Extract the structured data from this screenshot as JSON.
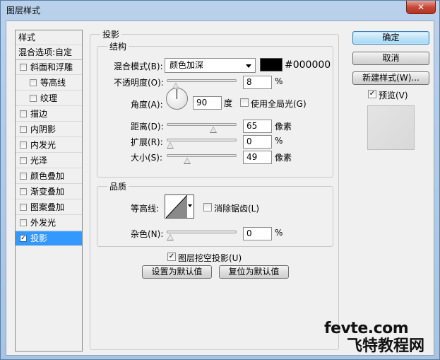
{
  "window": {
    "title": "图层样式",
    "close_label": "✕"
  },
  "sidebar": {
    "header": "样式",
    "blend_options": "混合选项:自定",
    "items": [
      {
        "label": "斜面和浮雕",
        "checked": false
      },
      {
        "label": "等高线",
        "checked": false
      },
      {
        "label": "纹理",
        "checked": false
      },
      {
        "label": "描边",
        "checked": false
      },
      {
        "label": "内阴影",
        "checked": false
      },
      {
        "label": "内发光",
        "checked": false
      },
      {
        "label": "光泽",
        "checked": false
      },
      {
        "label": "颜色叠加",
        "checked": false
      },
      {
        "label": "渐变叠加",
        "checked": false
      },
      {
        "label": "图案叠加",
        "checked": false
      },
      {
        "label": "外发光",
        "checked": false
      },
      {
        "label": "投影",
        "checked": true
      }
    ],
    "check_mark": "✓"
  },
  "shadow": {
    "group_title": "投影",
    "structure": {
      "title": "结构",
      "blend_mode_label": "混合模式(B):",
      "blend_mode_value": "颜色加深",
      "color_hex": "#000000",
      "color_swatch": "#000000",
      "opacity_label": "不透明度(O):",
      "opacity_value": "8",
      "opacity_unit": "%",
      "opacity_fraction": 0.08,
      "angle_label": "角度(A):",
      "angle_value": "90",
      "angle_unit": "度",
      "global_light_label": "使用全局光(G)",
      "global_light_checked": false,
      "distance_label": "距离(D):",
      "distance_value": "65",
      "distance_unit": "像素",
      "distance_fraction": 0.65,
      "spread_label": "扩展(R):",
      "spread_value": "0",
      "spread_unit": "%",
      "spread_fraction": 0.0,
      "size_label": "大小(S):",
      "size_value": "49",
      "size_unit": "像素",
      "size_fraction": 0.25
    },
    "quality": {
      "title": "品质",
      "contour_label": "等高线:",
      "antialias_label": "消除锯齿(L)",
      "antialias_checked": false,
      "noise_label": "杂色(N):",
      "noise_value": "0",
      "noise_unit": "%",
      "noise_fraction": 0.0
    },
    "knockout_label": "图层挖空投影(U)",
    "knockout_checked": true,
    "make_default": "设置为默认值",
    "reset_default": "复位为默认值"
  },
  "buttons": {
    "ok": "确定",
    "cancel": "取消",
    "new_style": "新建样式(W)...",
    "preview_label": "预览(V)",
    "preview_checked": true
  },
  "watermark": {
    "line1": "fevte.com",
    "line2": "飞特教程网"
  }
}
